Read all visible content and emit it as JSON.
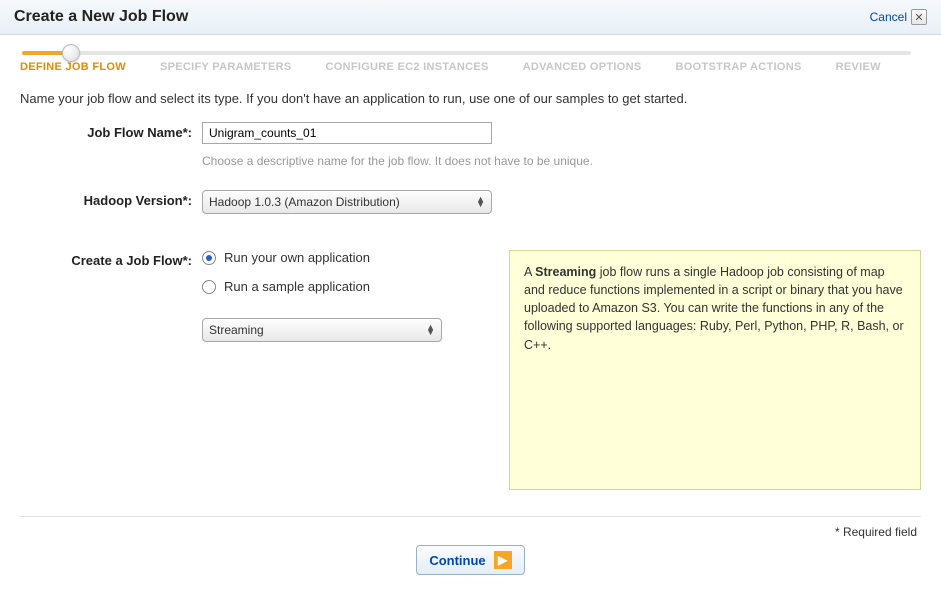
{
  "header": {
    "title": "Create a New Job Flow",
    "cancel_label": "Cancel"
  },
  "steps": [
    {
      "label": "DEFINE JOB FLOW",
      "active": true
    },
    {
      "label": "SPECIFY PARAMETERS",
      "active": false
    },
    {
      "label": "CONFIGURE EC2 INSTANCES",
      "active": false
    },
    {
      "label": "ADVANCED OPTIONS",
      "active": false
    },
    {
      "label": "BOOTSTRAP ACTIONS",
      "active": false
    },
    {
      "label": "REVIEW",
      "active": false
    }
  ],
  "intro": "Name your job flow and select its type. If you don't have an application to run, use one of our samples to get started.",
  "form": {
    "jobflow_name_label": "Job Flow Name*:",
    "jobflow_name_value": "Unigram_counts_01",
    "jobflow_name_hint": "Choose a descriptive name for the job flow. It does not have to be unique.",
    "hadoop_version_label": "Hadoop Version*:",
    "hadoop_version_value": "Hadoop 1.0.3 (Amazon Distribution)",
    "create_label": "Create a Job Flow*:",
    "radio_own": "Run your own application",
    "radio_sample": "Run a sample application",
    "app_type_value": "Streaming"
  },
  "info": {
    "prefix": "A ",
    "bold": "Streaming",
    "suffix": " job flow runs a single Hadoop job consisting of map and reduce functions implemented in a script or binary that you have uploaded to Amazon S3. You can write the functions in any of the following supported languages: Ruby, Perl, Python, PHP, R, Bash, or C++."
  },
  "footer": {
    "required_note": "* Required field",
    "continue_label": "Continue"
  }
}
